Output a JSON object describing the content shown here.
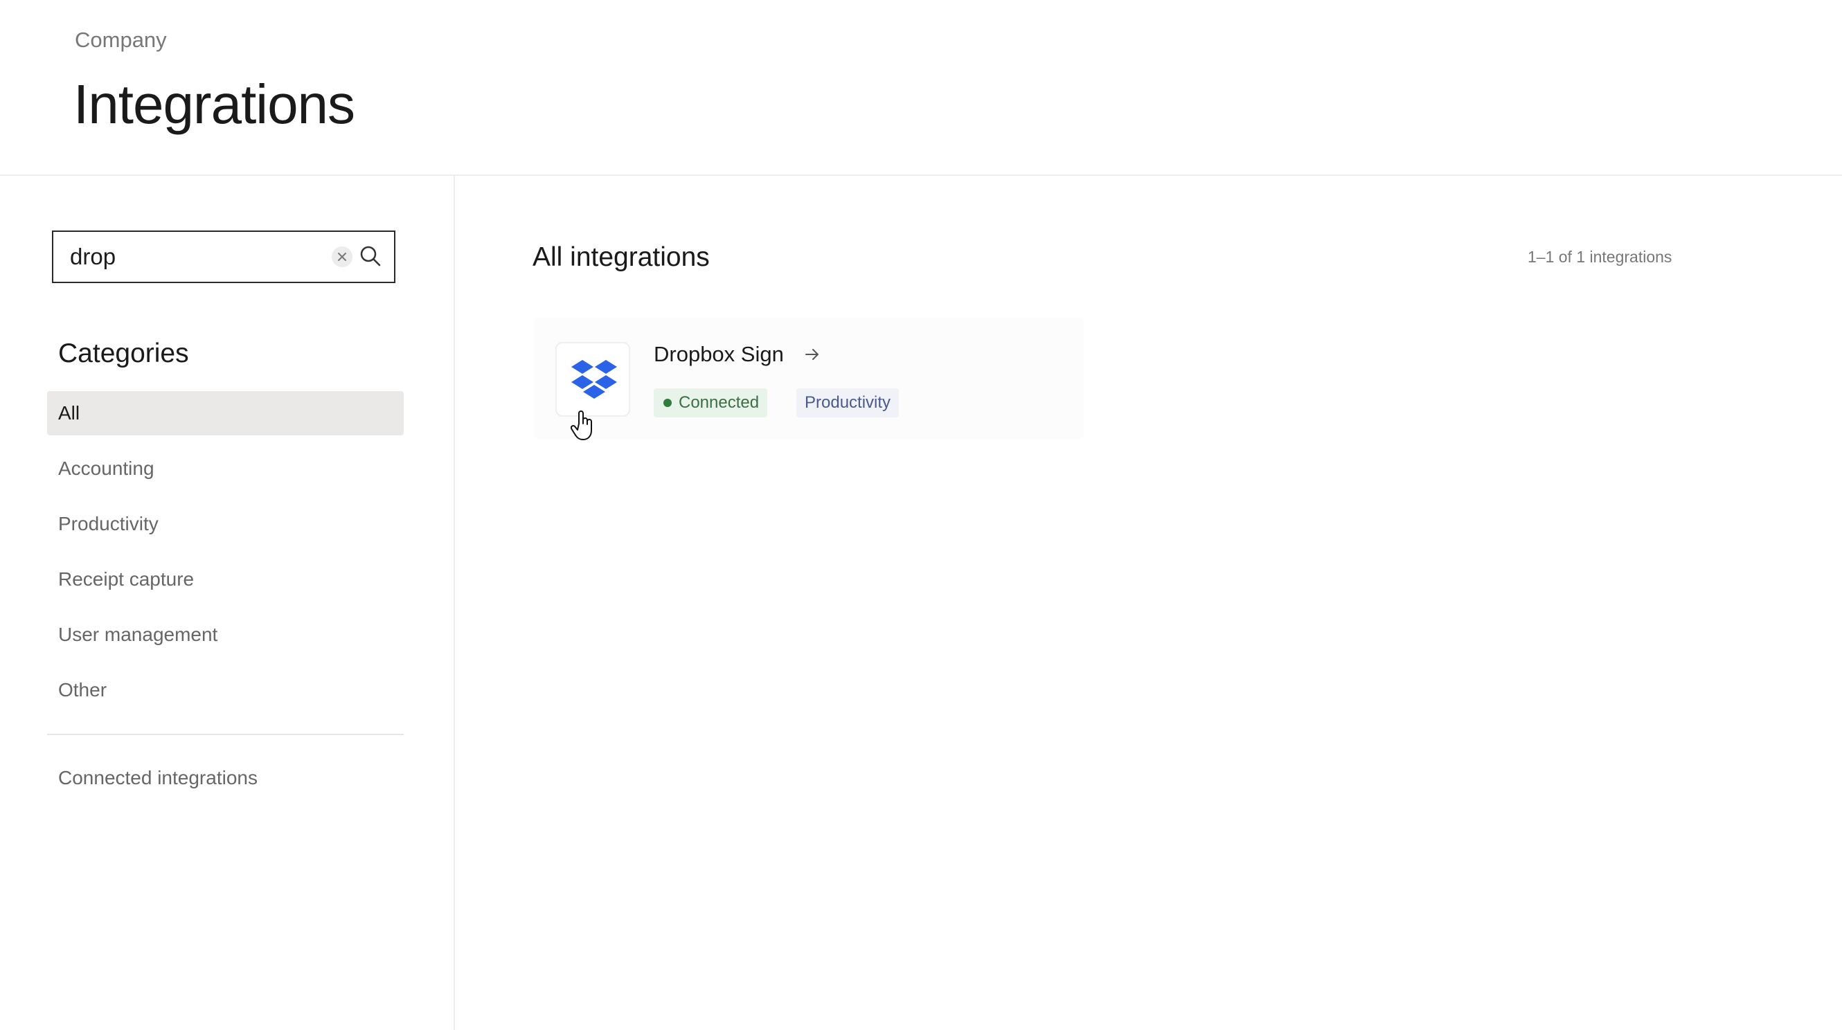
{
  "header": {
    "breadcrumb": "Company",
    "title": "Integrations"
  },
  "search": {
    "value": "drop",
    "placeholder": "",
    "icons": {
      "clear": "clear-icon",
      "search": "search-icon"
    }
  },
  "sidebar": {
    "categories_title": "Categories",
    "categories": [
      {
        "label": "All",
        "active": true
      },
      {
        "label": "Accounting",
        "active": false
      },
      {
        "label": "Productivity",
        "active": false
      },
      {
        "label": "Receipt capture",
        "active": false
      },
      {
        "label": "User management",
        "active": false
      },
      {
        "label": "Other",
        "active": false
      }
    ],
    "connected_link": "Connected integrations"
  },
  "main": {
    "title": "All integrations",
    "result_count": "1–1 of 1 integrations",
    "integrations": [
      {
        "name": "Dropbox Sign",
        "logo": "dropbox-logo",
        "status": "Connected",
        "category": "Productivity",
        "arrow_icon": "arrow-right-icon"
      }
    ]
  },
  "colors": {
    "active_category_bg": "#ebe9e7",
    "connected_badge_bg": "#e8f3ea",
    "connected_badge_text": "#3c6e45",
    "category_badge_bg": "#f0f2f8",
    "category_badge_text": "#4a5a8a",
    "dropbox_blue": "#2a62e8"
  }
}
